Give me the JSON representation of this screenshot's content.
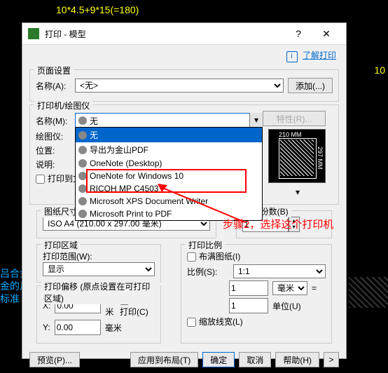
{
  "bg": {
    "formula": "10*4.5+9*15(=180)",
    "t1": "吕合金",
    "t2": "金的尺",
    "t3": "标准",
    "num": "10"
  },
  "title": "打印 - 模型",
  "helpLink": "了解打印",
  "page": {
    "title": "页面设置",
    "nameLbl": "名称(A):",
    "nameVal": "<无>",
    "addBtn": "添加(...)"
  },
  "printer": {
    "title": "打印机/绘图仪",
    "nameLbl": "名称(M):",
    "sel": "无",
    "plotterLbl": "绘图仪:",
    "locLbl": "位置:",
    "descLbl": "说明:",
    "opts": [
      "无",
      "导出为金山PDF",
      "OneNote (Desktop)",
      "OneNote for Windows 10",
      "RICOH MP C4503",
      "Microsoft XPS Document Writer",
      "Microsoft Print to PDF"
    ],
    "propBtn": "特性(R)...",
    "toFile": "打印到文",
    "preview": {
      "w": "210 MM",
      "h": "297 MM"
    }
  },
  "paper": {
    "title": "图纸尺寸(Z)",
    "val": "ISO A4 (210.00 x 297.00 毫米)"
  },
  "copies": {
    "title": "打印份数(B)",
    "val": "1"
  },
  "area": {
    "title": "打印区域",
    "rangeLbl": "打印范围(W):",
    "val": "显示"
  },
  "scale": {
    "title": "打印比例",
    "fit": "布满图纸(I)",
    "ratioLbl": "比例(S):",
    "ratio": "1:1",
    "v1": "1",
    "u1": "毫米",
    "eq": "=",
    "v2": "1",
    "u2": "单位(U)",
    "lw": "缩放线宽(L)"
  },
  "offset": {
    "title": "打印偏移 (原点设置在可打印区域)",
    "xLbl": "X:",
    "xVal": "0.00",
    "yLbl": "Y:",
    "yVal": "0.00",
    "unit": "毫米",
    "center": "居中打印(C)"
  },
  "buttons": {
    "preview": "预览(P)...",
    "apply": "应用到布局(T)",
    "ok": "确定",
    "cancel": "取消",
    "help": "帮助(H)",
    "expand": ">"
  },
  "annotation": "步骤2，选择这个打印机"
}
